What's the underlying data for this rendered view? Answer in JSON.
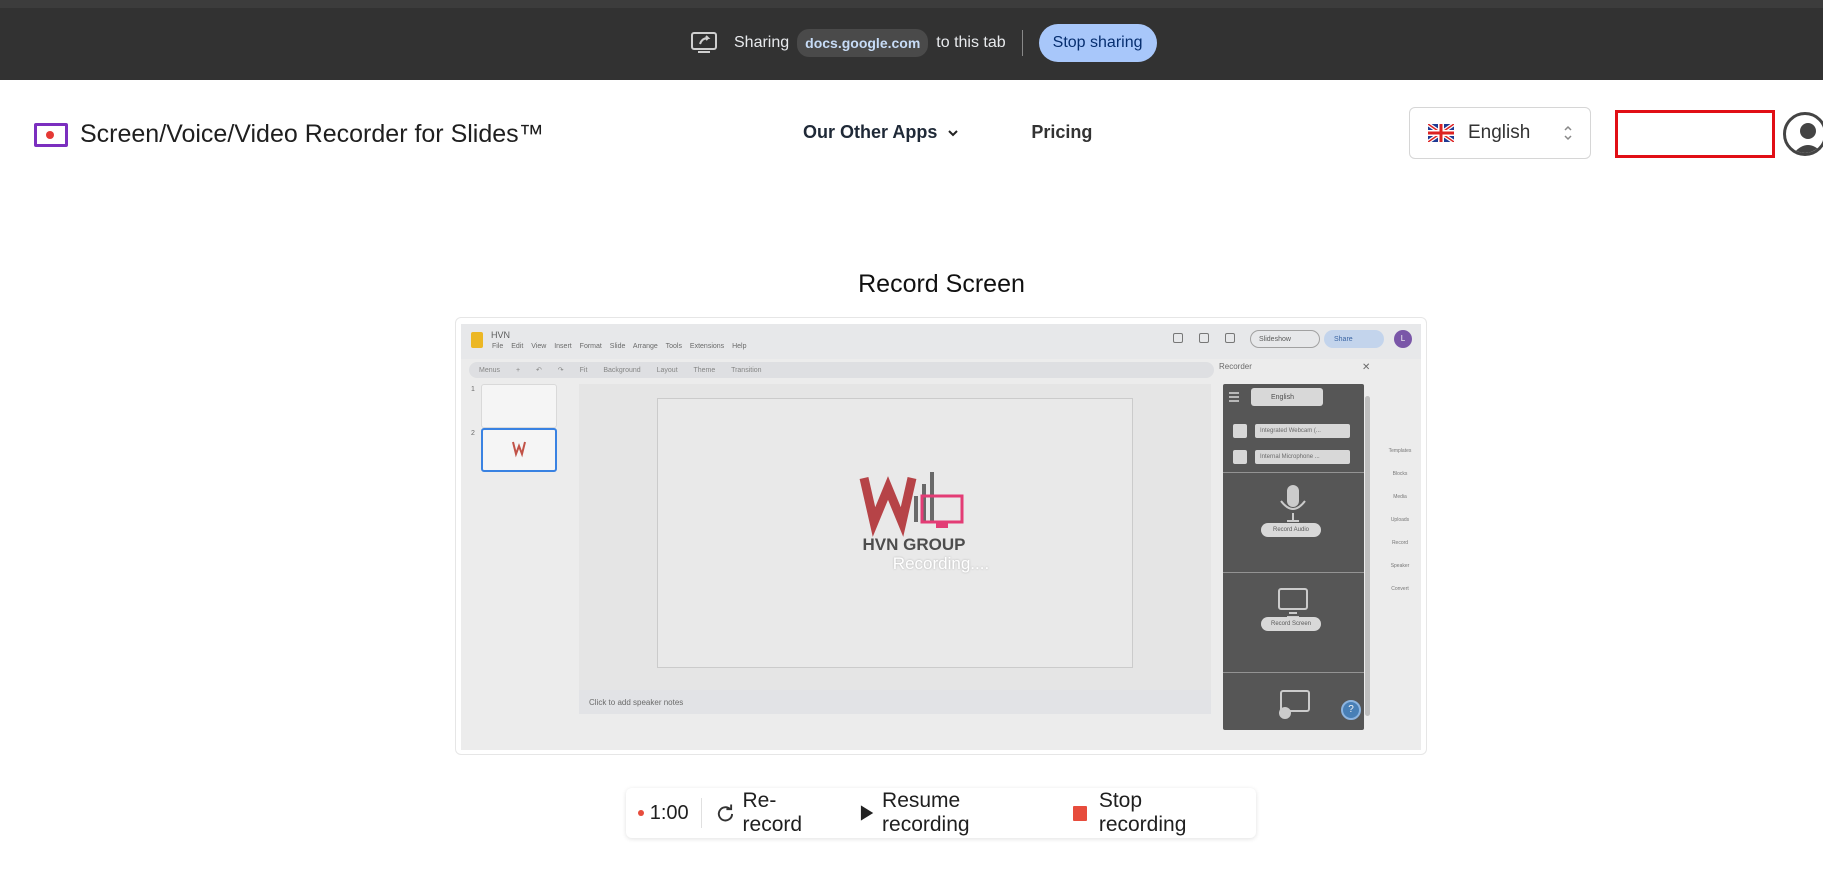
{
  "share_bar": {
    "sharing_label": "Sharing",
    "domain": "docs.google.com",
    "target_label": "to this tab",
    "stop_button": "Stop sharing"
  },
  "header": {
    "brand_title": "Screen/Voice/Video Recorder for Slides™",
    "nav": {
      "other_apps": "Our Other Apps",
      "pricing": "Pricing"
    },
    "language": "English"
  },
  "main": {
    "title": "Record Screen",
    "preview": {
      "doc_title": "HVN",
      "menu": "File Edit View Insert Format Slide Arrange Tools Extensions Help",
      "toolbar": "Menus + ↶ ↷ Fit Background Layout Theme Transition",
      "slideshow": "Slideshow",
      "share": "Share",
      "user_initial": "L",
      "thumb_numbers": [
        "1",
        "2"
      ],
      "slide_logo_text": "HVN GROUP",
      "speaker_notes": "Click to add speaker notes",
      "recording_text": "Recording....",
      "recorder": {
        "title": "Recorder",
        "language": "English",
        "camera": "Integrated Webcam (...",
        "microphone": "Internal Microphone ...",
        "record_audio": "Record Audio",
        "record_screen": "Record Screen"
      },
      "right_rail": [
        "Templates",
        "Blocks",
        "Media",
        "Uploads",
        "Record",
        "Speaker",
        "Convert"
      ]
    }
  },
  "controls": {
    "timer": "1:00",
    "rerecord": "Re-record",
    "resume": "Resume recording",
    "stop": "Stop recording"
  },
  "colors": {
    "accent_blue": "#a8c7fa",
    "record_red": "#e74c3c",
    "highlight_red": "#e10f16",
    "brand_purple": "#7b2fbf"
  }
}
